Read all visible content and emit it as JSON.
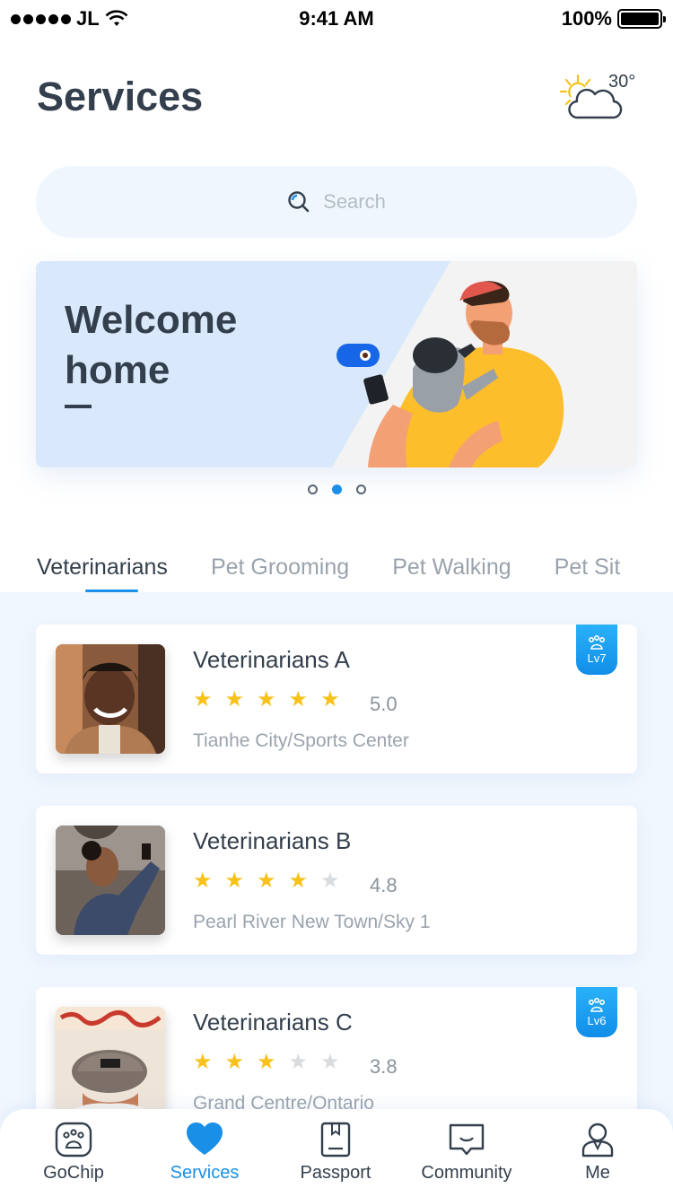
{
  "status_bar": {
    "carrier": "JL",
    "time": "9:41 AM",
    "battery": "100%"
  },
  "header": {
    "title": "Services",
    "temperature": "30°",
    "weather_icon": "partly-cloudy-icon"
  },
  "search": {
    "placeholder": "Search"
  },
  "banner": {
    "title": "Welcome home",
    "slide_count": 3,
    "active_slide": 2
  },
  "tabs": [
    {
      "label": "Veterinarians",
      "active": true
    },
    {
      "label": "Pet Grooming",
      "active": false
    },
    {
      "label": "Pet Walking",
      "active": false
    },
    {
      "label": "Pet Sit",
      "active": false
    }
  ],
  "vets": [
    {
      "name": "Veterinarians A",
      "rating": "5.0",
      "stars": 5,
      "location": "Tianhe City/Sports Center",
      "badge": "Lv7"
    },
    {
      "name": "Veterinarians B",
      "rating": "4.8",
      "stars": 4,
      "location": "Pearl River New Town/Sky 1",
      "badge": null
    },
    {
      "name": "Veterinarians C",
      "rating": "3.8",
      "stars": 3,
      "location": "Grand Centre/Ontario",
      "badge": "Lv6"
    }
  ],
  "tabbar": [
    {
      "label": "GoChip",
      "icon": "paw-icon",
      "active": false
    },
    {
      "label": "Services",
      "icon": "heart-icon",
      "active": true
    },
    {
      "label": "Passport",
      "icon": "passport-icon",
      "active": false
    },
    {
      "label": "Community",
      "icon": "chat-icon",
      "active": false
    },
    {
      "label": "Me",
      "icon": "person-icon",
      "active": false
    }
  ],
  "colors": {
    "accent": "#1a8fe8",
    "star": "#f8c21a",
    "list_bg": "#f1f7fe",
    "banner_blue": "#d8e9fb"
  }
}
